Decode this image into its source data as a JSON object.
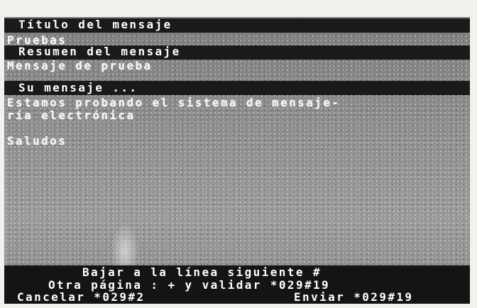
{
  "form": {
    "title_label": "Título del mensaje",
    "title_value": "Pruebas",
    "summary_label": "Resumen del mensaje",
    "summary_value": "Mensaje de prueba",
    "body_label": "Su mensaje ...",
    "body_line1": "Estamos probando el sistema de mensaje-",
    "body_line2": "ría electrónica",
    "body_line3": "Saludos"
  },
  "footer": {
    "line1": "Bajar a la línea siguiente #",
    "line2": "Otra página : + y validar *029#19",
    "cancel_label": "Cancelar *029#2",
    "send_label": "Enviar *029#19"
  }
}
